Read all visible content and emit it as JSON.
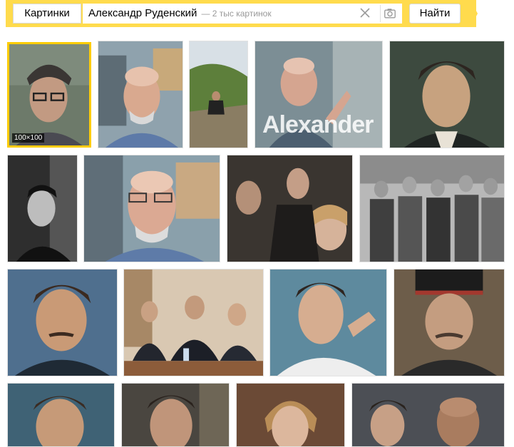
{
  "search": {
    "tab_label": "Картинки",
    "query": "Александр Руденский",
    "count_label": "— 2 тыс картинок",
    "submit_label": "Найти"
  },
  "results": [
    {
      "name": "portrait-glasses-man",
      "size_label": "100×100",
      "selected": true
    },
    {
      "name": "scientist-lab-glasses"
    },
    {
      "name": "man-sitting-hillside"
    },
    {
      "name": "speaker-with-caption",
      "overlay_text": "Alexander"
    },
    {
      "name": "young-man-portrait-sepia"
    },
    {
      "name": "young-man-bw-portrait"
    },
    {
      "name": "scientist-lab-closeup"
    },
    {
      "name": "film-still-group"
    },
    {
      "name": "protest-crowd-bw"
    },
    {
      "name": "officer-mustache-portrait"
    },
    {
      "name": "press-conference-panel"
    },
    {
      "name": "man-gesturing-film-still"
    },
    {
      "name": "cossack-officer-cap"
    },
    {
      "name": "actor-closeup-bottom-1"
    },
    {
      "name": "actor-closeup-bottom-2"
    },
    {
      "name": "actress-closeup-bottom"
    },
    {
      "name": "two-men-film-still-bottom"
    }
  ]
}
